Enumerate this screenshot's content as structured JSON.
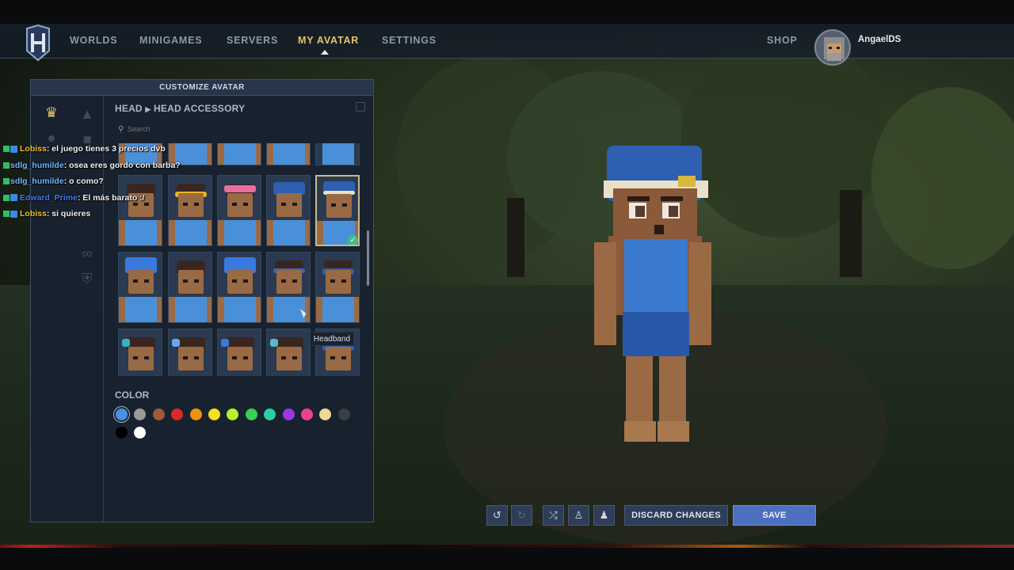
{
  "nav": {
    "items": [
      "WORLDS",
      "MINIGAMES",
      "SERVERS",
      "MY AVATAR",
      "SETTINGS"
    ],
    "active": "MY AVATAR",
    "shop": "SHOP",
    "username": "AngaelDS"
  },
  "panel": {
    "title": "CUSTOMIZE AVATAR",
    "breadcrumb_parent": "HEAD",
    "breadcrumb_child": "HEAD ACCESSORY",
    "search_placeholder": "Search",
    "color_label": "COLOR",
    "tooltip": "Headband",
    "colors": [
      "#4a90e2",
      "#9a9a9a",
      "#a0593a",
      "#d62a2a",
      "#f09010",
      "#f5e020",
      "#b8f030",
      "#38d050",
      "#2ad0a0",
      "#9a38e8",
      "#f0408a",
      "#f0d898",
      "#3a3f46",
      "#000000",
      "#ffffff"
    ],
    "selected_color": 0
  },
  "chat": [
    {
      "user": "Lobiss",
      "user_color": "#f0c030",
      "msg": ": el juego tienes 3 precios dvb"
    },
    {
      "user": "sdlg_humilde",
      "user_color": "#6fb8ff",
      "msg": ": osea eres gordo con barba?"
    },
    {
      "user": "sdlg_humilde",
      "user_color": "#6fb8ff",
      "msg": ": o como?"
    },
    {
      "user": "Edward_Prime",
      "user_color": "#4a7ae8",
      "msg": ": El más barato :/"
    },
    {
      "user": "Lobiss",
      "user_color": "#f0c030",
      "msg": ": si quieres"
    }
  ],
  "toolbar": {
    "discard": "DISCARD CHANGES",
    "save": "SAVE"
  },
  "icons": [
    "undo-icon",
    "redo-icon",
    "shuffle-icon",
    "character-icon",
    "character-reset-icon"
  ]
}
